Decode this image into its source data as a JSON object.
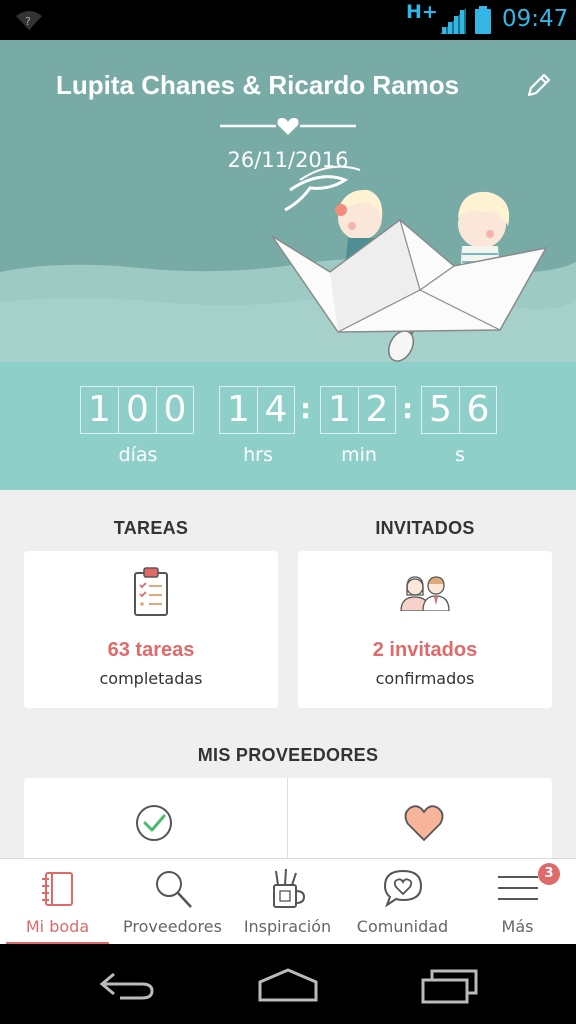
{
  "status_bar": {
    "network": "H+",
    "time": "09:47"
  },
  "hero": {
    "couple_name": "Lupita Chanes & Ricardo Ramos",
    "wedding_date": "26/11/2016"
  },
  "countdown": {
    "days": [
      "1",
      "0",
      "0"
    ],
    "hours": [
      "1",
      "4"
    ],
    "minutes": [
      "1",
      "2"
    ],
    "seconds": [
      "5",
      "6"
    ],
    "labels": {
      "days": "días",
      "hours": "hrs",
      "minutes": "min",
      "seconds": "s"
    }
  },
  "tasks": {
    "title": "TAREAS",
    "count_text": "63 tareas",
    "status_text": "completadas"
  },
  "guests": {
    "title": "INVITADOS",
    "count_text": "2 invitados",
    "status_text": "confirmados"
  },
  "providers": {
    "title": "MIS PROVEEDORES"
  },
  "bottom_nav": {
    "items": [
      {
        "label": "Mi boda",
        "icon": "notebook-icon",
        "active": true
      },
      {
        "label": "Proveedores",
        "icon": "magnifier-icon",
        "active": false
      },
      {
        "label": "Inspiración",
        "icon": "pencil-cup-icon",
        "active": false
      },
      {
        "label": "Comunidad",
        "icon": "speech-heart-icon",
        "active": false
      },
      {
        "label": "Más",
        "icon": "hamburger-menu-icon",
        "active": false,
        "badge": "3"
      }
    ]
  },
  "colors": {
    "hero_bg": "#79aba6",
    "countdown_bg": "#8ecfc9",
    "accent": "#e06a6a",
    "status_accent": "#33b5e5"
  }
}
